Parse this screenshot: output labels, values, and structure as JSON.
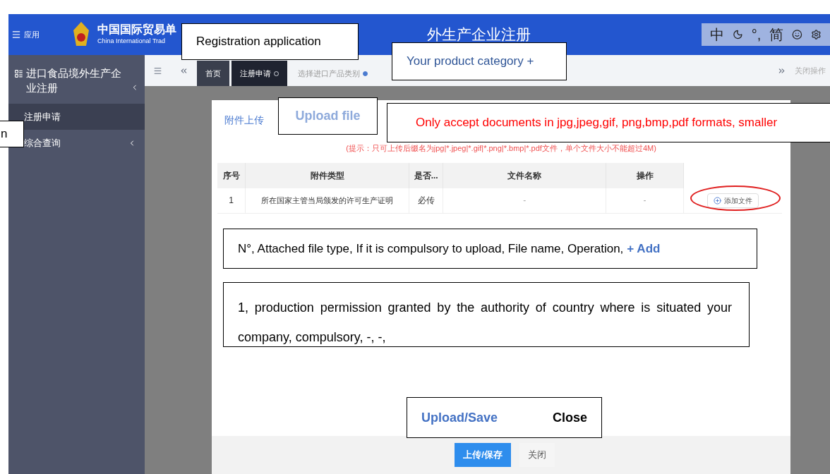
{
  "header": {
    "menu_label": "应用",
    "title_left": "中国国际贸易单",
    "title_right": "外生产企业注册",
    "subtitle": "China International Trad",
    "ime": [
      "中",
      "°,",
      "简"
    ]
  },
  "tabs": [
    {
      "label": "首页",
      "selected": false,
      "closable": false
    },
    {
      "label": "注册申请",
      "selected": true,
      "closable": true
    },
    {
      "label": "选择进口产品类别",
      "selected": false,
      "closable": true
    }
  ],
  "tab_bar_right": "关闭操作",
  "sidebar": {
    "title": "进口食品境外生产企业注册",
    "items": [
      {
        "label": "注册申请",
        "selected": true,
        "expandable": false
      },
      {
        "label": "综合查询",
        "selected": false,
        "expandable": true
      }
    ]
  },
  "dialog": {
    "title": "附件上传",
    "hint": "(提示：只可上传后缀名为jpg|*.jpeg|*.gif|*.png|*.bmp|*.pdf文件，单个文件大小不能超过4M)",
    "columns": [
      "序号",
      "附件类型",
      "是否...",
      "文件名称",
      "操作"
    ],
    "rows": [
      {
        "cells": [
          "1",
          "所在国家主管当局颁发的许可生产证明",
          "必传",
          "-",
          "-"
        ],
        "action": "添加文件"
      }
    ],
    "buttons": [
      {
        "label": "上传/保存",
        "kind": "primary"
      },
      {
        "label": "关闭",
        "kind": "plain"
      }
    ]
  },
  "annotations": {
    "registration": "Registration application",
    "category": "Your product category +",
    "side": "n",
    "upload": "Upload file",
    "formats": "Only accept documents in jpg,jpeg,gif, png,bmp,pdf formats, smaller",
    "columns": {
      "text": "N°, Attached file type, If it is compulsory to upload, File name, Operation,",
      "highlight": "+ Add"
    },
    "row": "1, production permission granted by the authority of country where is situated your company, compulsory, -, -,",
    "save": "Upload/Save",
    "close": "Close"
  }
}
